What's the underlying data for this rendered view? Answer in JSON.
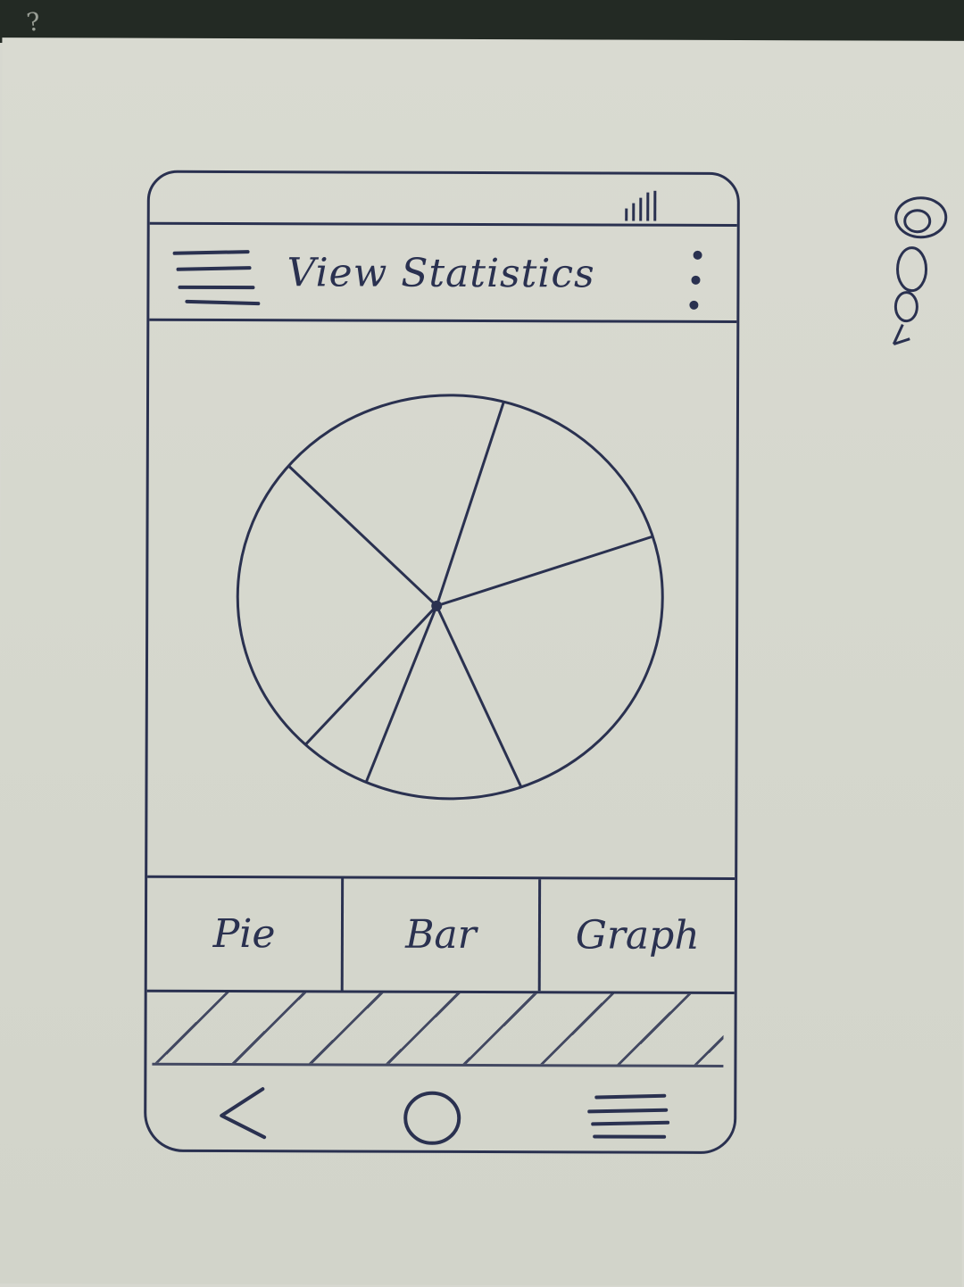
{
  "app_bar": {
    "title": "View Statistics",
    "menu_icon": "hamburger-menu-icon",
    "overflow_icon": "more-vert-icon"
  },
  "status_bar": {
    "signal_icon": "signal-icon"
  },
  "chart_data": {
    "type": "pie",
    "title": "",
    "categories": [
      "",
      "",
      "",
      "",
      "",
      ""
    ],
    "values": [
      15,
      23,
      13,
      6,
      25,
      18
    ]
  },
  "tabs": [
    {
      "label": "Pie"
    },
    {
      "label": "Bar"
    },
    {
      "label": "Graph"
    }
  ],
  "nav_bar": {
    "back_icon": "back-icon",
    "home_icon": "home-icon",
    "recents_icon": "recents-icon"
  },
  "colors": {
    "ink": "#2a3150",
    "paper": "#d7d8d0"
  }
}
